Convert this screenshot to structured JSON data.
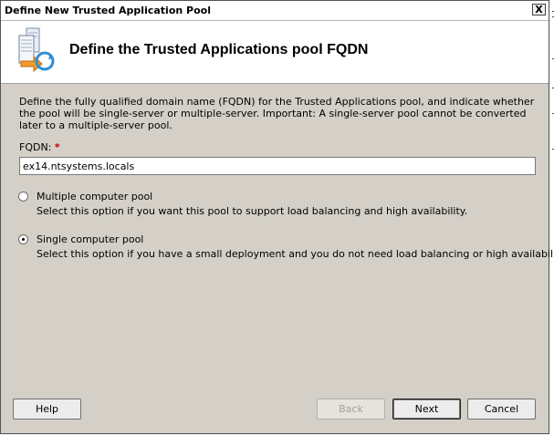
{
  "window": {
    "title": "Define New Trusted Application Pool",
    "close_label": "X"
  },
  "header": {
    "title": "Define the Trusted Applications pool FQDN",
    "icon": "server-pool-icon"
  },
  "description": "Define the fully qualified domain name (FQDN) for the Trusted Applications pool, and indicate whether the pool will be single-server or multiple-server. Important: A single-server pool cannot be converted later to a multiple-server pool.",
  "fqdn": {
    "label": "FQDN:",
    "required_marker": "*",
    "value": "ex14.ntsystems.locals"
  },
  "options": [
    {
      "label": "Multiple computer pool",
      "description": "Select this option if you want this pool to support load balancing and high availability.",
      "selected": false
    },
    {
      "label": "Single computer pool",
      "description": "Select this option if you have a small deployment and you do not need load balancing or high availability.",
      "selected": true
    }
  ],
  "buttons": {
    "help": "Help",
    "back": "Back",
    "next": "Next",
    "cancel": "Cancel"
  }
}
